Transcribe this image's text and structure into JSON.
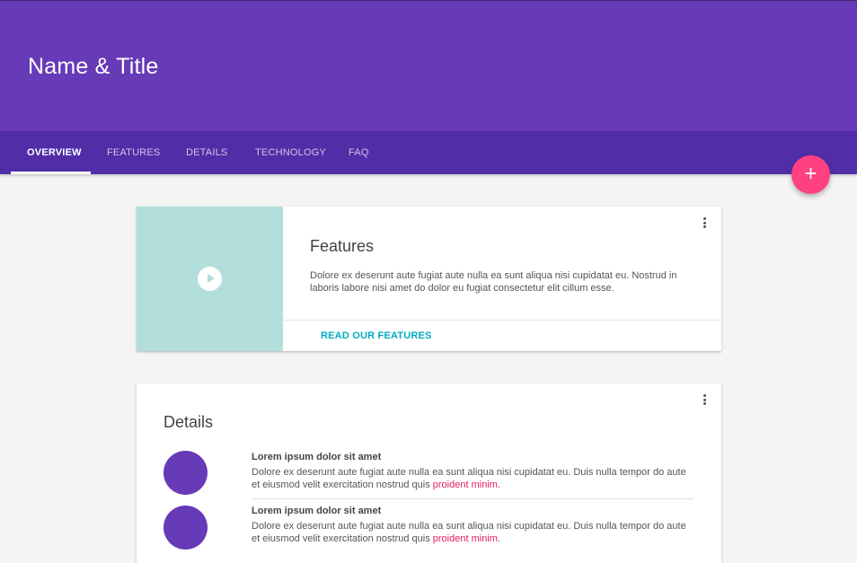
{
  "header": {
    "title": "Name & Title"
  },
  "tabs": [
    {
      "label": "OVERVIEW",
      "active": true
    },
    {
      "label": "FEATURES",
      "active": false
    },
    {
      "label": "DETAILS",
      "active": false
    },
    {
      "label": "TECHNOLOGY",
      "active": false
    },
    {
      "label": "FAQ",
      "active": false
    }
  ],
  "fab": {
    "icon": "plus-icon",
    "glyph": "+"
  },
  "features_card": {
    "title": "Features",
    "text": "Dolore ex deserunt aute fugiat aute nulla ea sunt aliqua nisi cupidatat eu. Nostrud in laboris labore nisi amet do dolor eu fugiat consectetur elit cillum esse.",
    "action": "READ OUR FEATURES",
    "media_icon": "play-icon",
    "menu_icon": "more-vert-icon"
  },
  "details_card": {
    "title": "Details",
    "menu_icon": "more-vert-icon",
    "items": [
      {
        "title": "Lorem ipsum dolor sit amet",
        "text": "Dolore ex deserunt aute fugiat aute nulla ea sunt aliqua nisi cupidatat eu. Duis nulla tempor do aute et eiusmod velit exercitation nostrud quis ",
        "link": "proident minim",
        "suffix": "."
      },
      {
        "title": "Lorem ipsum dolor sit amet",
        "text": "Dolore ex deserunt aute fugiat aute nulla ea sunt aliqua nisi cupidatat eu. Duis nulla tempor do aute et eiusmod velit exercitation nostrud quis ",
        "link": "proident minim",
        "suffix": "."
      }
    ]
  },
  "colors": {
    "primary": "#673ab7",
    "primary_dark": "#512da8",
    "accent": "#ff4081",
    "link": "#e91e63",
    "action": "#00acc1",
    "media": "#b2dfdb"
  }
}
